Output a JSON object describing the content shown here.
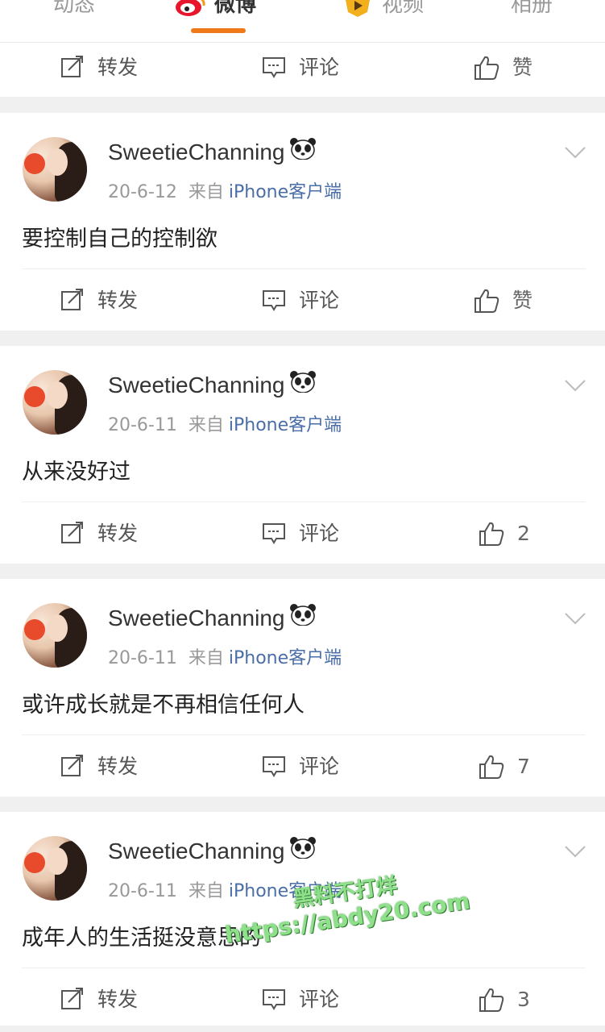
{
  "tabs": [
    {
      "label": "动态"
    },
    {
      "label": "微博",
      "active": true
    },
    {
      "label": "视频"
    },
    {
      "label": "相册"
    }
  ],
  "actions": {
    "repost_label": "转发",
    "comment_label": "评论",
    "like_label": "赞"
  },
  "posts": [
    {
      "user": "SweetieChanning",
      "date": "20-6-12",
      "from_label": "来自",
      "source": "iPhone客户端",
      "content": "要控制自己的控制欲",
      "likes": "赞"
    },
    {
      "user": "SweetieChanning",
      "date": "20-6-11",
      "from_label": "来自",
      "source": "iPhone客户端",
      "content": "从来没好过",
      "likes": "2"
    },
    {
      "user": "SweetieChanning",
      "date": "20-6-11",
      "from_label": "来自",
      "source": "iPhone客户端",
      "content": "或许成长就是不再相信任何人",
      "likes": "7"
    },
    {
      "user": "SweetieChanning",
      "date": "20-6-11",
      "from_label": "来自",
      "source": "iPhone客户端",
      "content": "成年人的生活挺没意思的",
      "likes": "3"
    }
  ],
  "watermark": {
    "line1": "黑料不打烊",
    "line2": "https://abdy20.com"
  },
  "colors": {
    "accent": "#f07a1a",
    "source_link": "#4a6ea8",
    "separator": "#f0f0f0",
    "watermark": "#8fe08a"
  },
  "icons": {
    "repost": "repost-icon",
    "comment": "comment-icon",
    "like": "thumbs-up-icon",
    "chevron": "chevron-down-icon",
    "badge": "panda-icon"
  }
}
